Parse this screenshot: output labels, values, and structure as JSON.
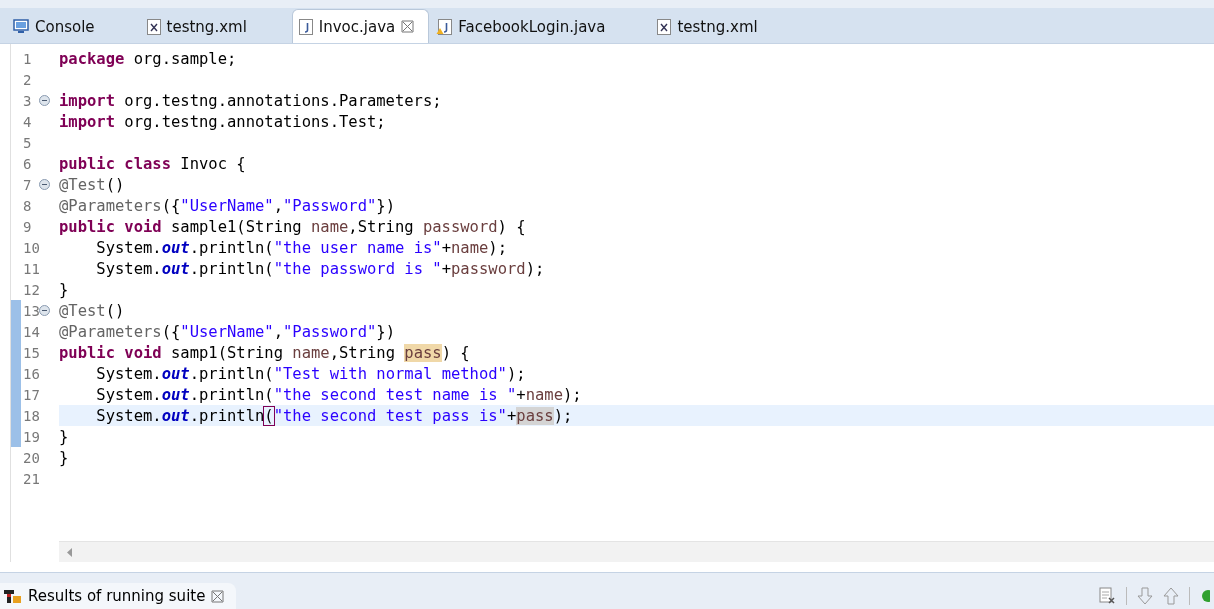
{
  "tabs": [
    {
      "label": "Console",
      "kind": "console",
      "selected": false,
      "closable": false
    },
    {
      "label": "testng.xml",
      "kind": "xml",
      "selected": false,
      "closable": false
    },
    {
      "label": "Invoc.java",
      "kind": "java",
      "selected": true,
      "closable": true
    },
    {
      "label": "FacebookLogin.java",
      "kind": "java-warning",
      "selected": false,
      "closable": false
    },
    {
      "label": "testng.xml",
      "kind": "xml",
      "selected": false,
      "closable": false
    }
  ],
  "editor": {
    "lines": [
      {
        "number": "1",
        "fold": false,
        "changed": false,
        "current": false,
        "tokens": [
          {
            "text": "package",
            "kind": "kw"
          },
          {
            "text": " org.sample;",
            "kind": "plain"
          }
        ]
      },
      {
        "number": "2",
        "fold": false,
        "changed": false,
        "current": false
      },
      {
        "number": "3",
        "fold": true,
        "changed": false,
        "current": false,
        "tokens": [
          {
            "text": "import",
            "kind": "kw"
          },
          {
            "text": " org.testng.annotations.Parameters;",
            "kind": "plain"
          }
        ]
      },
      {
        "number": "4",
        "fold": false,
        "changed": false,
        "current": false,
        "tokens": [
          {
            "text": "import",
            "kind": "kw"
          },
          {
            "text": " org.testng.annotations.Test;",
            "kind": "plain"
          }
        ]
      },
      {
        "number": "5",
        "fold": false,
        "changed": false,
        "current": false
      },
      {
        "number": "6",
        "fold": false,
        "changed": false,
        "current": false,
        "tokens": [
          {
            "text": "public class",
            "kind": "kw"
          },
          {
            "text": " Invoc {",
            "kind": "plain"
          }
        ]
      },
      {
        "number": "7",
        "fold": true,
        "changed": false,
        "current": false,
        "tokens": [
          {
            "text": "@Test",
            "kind": "ann"
          },
          {
            "text": "()",
            "kind": "plain"
          }
        ]
      },
      {
        "number": "8",
        "fold": false,
        "changed": false,
        "current": false,
        "tokens": [
          {
            "text": "@Parameters",
            "kind": "ann"
          },
          {
            "text": "({",
            "kind": "plain"
          },
          {
            "text": "\"UserName\"",
            "kind": "str"
          },
          {
            "text": ",",
            "kind": "plain"
          },
          {
            "text": "\"Password\"",
            "kind": "str"
          },
          {
            "text": "})",
            "kind": "plain"
          }
        ]
      },
      {
        "number": "9",
        "fold": false,
        "changed": false,
        "current": false,
        "tokens": [
          {
            "text": "public void",
            "kind": "kw"
          },
          {
            "text": " sample1(String ",
            "kind": "plain"
          },
          {
            "text": "name",
            "kind": "var"
          },
          {
            "text": ",String ",
            "kind": "plain"
          },
          {
            "text": "password",
            "kind": "var"
          },
          {
            "text": ") {",
            "kind": "plain"
          }
        ]
      },
      {
        "number": "10",
        "fold": false,
        "changed": false,
        "current": false,
        "tokens": [
          {
            "text": "    System.",
            "kind": "plain"
          },
          {
            "text": "out",
            "kind": "field"
          },
          {
            "text": ".println(",
            "kind": "plain"
          },
          {
            "text": "\"the user name is\"",
            "kind": "str"
          },
          {
            "text": "+",
            "kind": "plain"
          },
          {
            "text": "name",
            "kind": "var"
          },
          {
            "text": ");",
            "kind": "plain"
          }
        ]
      },
      {
        "number": "11",
        "fold": false,
        "changed": false,
        "current": false,
        "tokens": [
          {
            "text": "    System.",
            "kind": "plain"
          },
          {
            "text": "out",
            "kind": "field"
          },
          {
            "text": ".println(",
            "kind": "plain"
          },
          {
            "text": "\"the password is \"",
            "kind": "str"
          },
          {
            "text": "+",
            "kind": "plain"
          },
          {
            "text": "password",
            "kind": "var"
          },
          {
            "text": ");",
            "kind": "plain"
          }
        ]
      },
      {
        "number": "12",
        "fold": false,
        "changed": false,
        "current": false,
        "tokens": [
          {
            "text": "}",
            "kind": "plain"
          }
        ]
      },
      {
        "number": "13",
        "fold": true,
        "changed": true,
        "current": false,
        "tokens": [
          {
            "text": "@Test",
            "kind": "ann"
          },
          {
            "text": "()",
            "kind": "plain"
          }
        ]
      },
      {
        "number": "14",
        "fold": false,
        "changed": true,
        "current": false,
        "tokens": [
          {
            "text": "@Parameters",
            "kind": "ann"
          },
          {
            "text": "({",
            "kind": "plain"
          },
          {
            "text": "\"UserName\"",
            "kind": "str"
          },
          {
            "text": ",",
            "kind": "plain"
          },
          {
            "text": "\"Password\"",
            "kind": "str"
          },
          {
            "text": "})",
            "kind": "plain"
          }
        ]
      },
      {
        "number": "15",
        "fold": false,
        "changed": true,
        "current": false,
        "tokens": [
          {
            "text": "public void",
            "kind": "kw"
          },
          {
            "text": " samp1(String ",
            "kind": "plain"
          },
          {
            "text": "name",
            "kind": "var"
          },
          {
            "text": ",String ",
            "kind": "plain"
          },
          {
            "text": "pass",
            "kind": "decl"
          },
          {
            "text": ") {",
            "kind": "plain"
          }
        ]
      },
      {
        "number": "16",
        "fold": false,
        "changed": true,
        "current": false,
        "tokens": [
          {
            "text": "    System.",
            "kind": "plain"
          },
          {
            "text": "out",
            "kind": "field"
          },
          {
            "text": ".println(",
            "kind": "plain"
          },
          {
            "text": "\"Test with normal method\"",
            "kind": "str"
          },
          {
            "text": ");",
            "kind": "plain"
          }
        ]
      },
      {
        "number": "17",
        "fold": false,
        "changed": true,
        "current": false,
        "tokens": [
          {
            "text": "    System.",
            "kind": "plain"
          },
          {
            "text": "out",
            "kind": "field"
          },
          {
            "text": ".println(",
            "kind": "plain"
          },
          {
            "text": "\"the second test name is \"",
            "kind": "str"
          },
          {
            "text": "+",
            "kind": "plain"
          },
          {
            "text": "name",
            "kind": "var"
          },
          {
            "text": ");",
            "kind": "plain"
          }
        ]
      },
      {
        "number": "18",
        "fold": false,
        "changed": true,
        "current": true,
        "tokens": [
          {
            "text": "    System.",
            "kind": "plain"
          },
          {
            "text": "out",
            "kind": "field"
          },
          {
            "text": ".println",
            "kind": "plain"
          },
          {
            "text": "(",
            "kind": "bracket"
          },
          {
            "text": "\"the second test pass is\"",
            "kind": "str"
          },
          {
            "text": "+",
            "kind": "plain"
          },
          {
            "text": "pass",
            "kind": "occurrence"
          },
          {
            "text": ");",
            "kind": "plain"
          }
        ]
      },
      {
        "number": "19",
        "fold": false,
        "changed": true,
        "current": false,
        "tokens": [
          {
            "text": "}",
            "kind": "plain"
          }
        ]
      },
      {
        "number": "20",
        "fold": false,
        "changed": false,
        "current": false,
        "tokens": [
          {
            "text": "}",
            "kind": "plain"
          }
        ]
      },
      {
        "number": "21",
        "fold": false,
        "changed": false,
        "current": false
      }
    ]
  },
  "bottom_panel": {
    "title": "Results of running suite"
  }
}
